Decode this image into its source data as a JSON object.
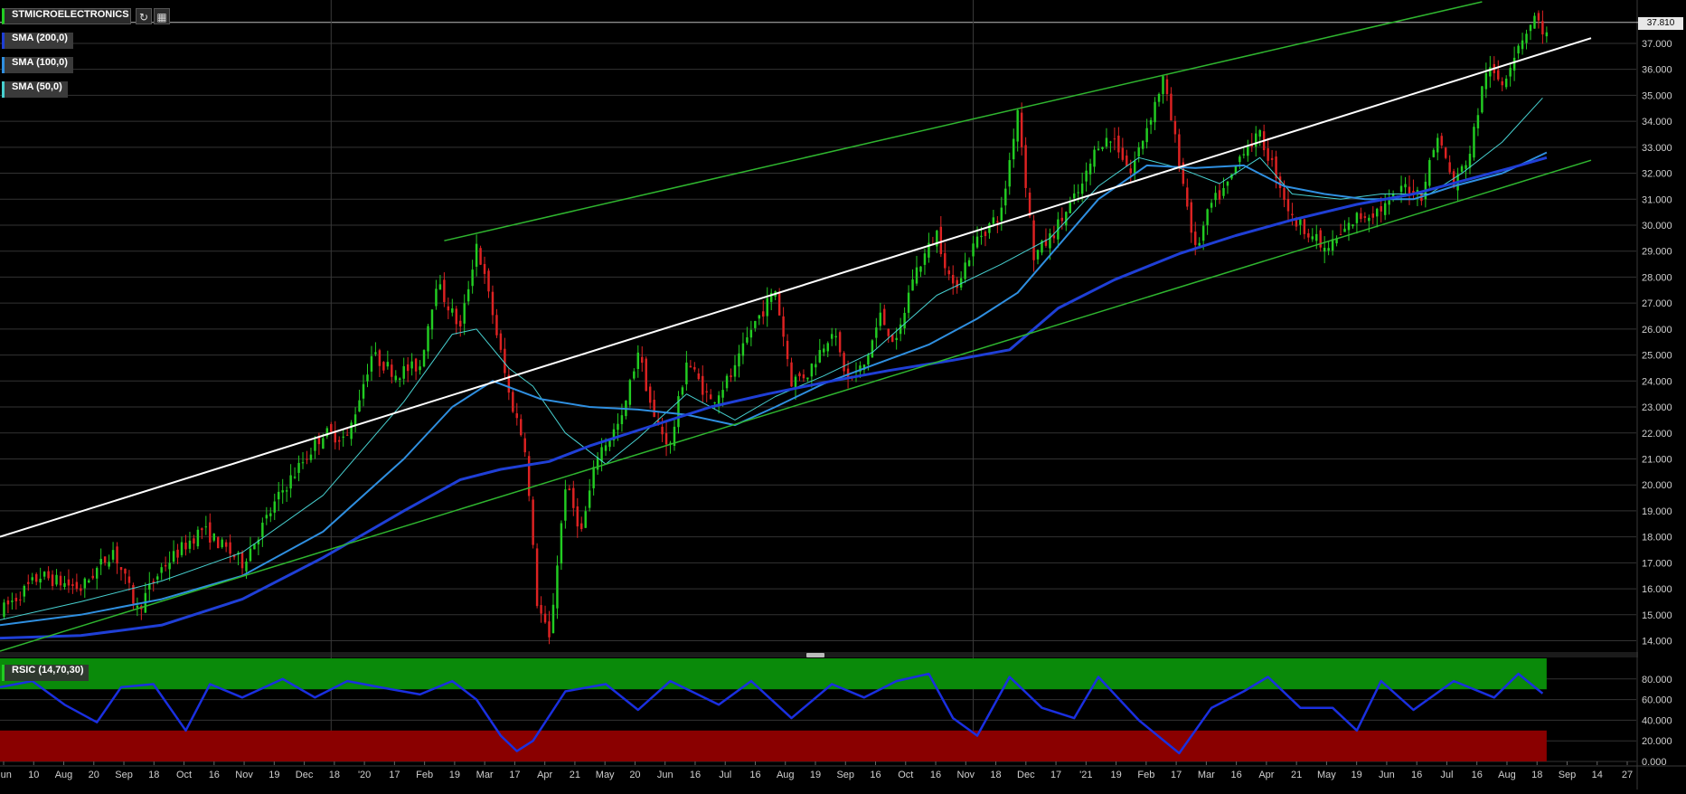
{
  "toolbar": {
    "symbol": "STMICROELECTRONICS",
    "refresh_icon": "refresh-icon",
    "calendar_icon": "calendar-icon"
  },
  "legend": {
    "sma200": "SMA (200,0)",
    "sma100": "SMA (100,0)",
    "sma50": "SMA (50,0)",
    "rsi": "RSIC (14,70,30)"
  },
  "colors": {
    "background": "#000000",
    "up": "#22cc22",
    "down": "#dd2222",
    "sma200": "#1f3fd6",
    "sma100": "#2f8fe0",
    "sma50": "#47d0d0",
    "trend_green": "#2fb52f",
    "trend_white": "#ffffff",
    "rsi_line": "#1a2fe0",
    "overbought_zone": "#0a8a0a",
    "oversold_zone": "#8a0000"
  },
  "chart_data": [
    {
      "type": "candlestick",
      "title": "STMICROELECTRONICS",
      "last_price": "37.810",
      "ylim": [
        13.6,
        38.6
      ],
      "y_ticks": [
        "14.000",
        "15.000",
        "16.000",
        "17.000",
        "18.000",
        "19.000",
        "20.000",
        "21.000",
        "22.000",
        "23.000",
        "24.000",
        "25.000",
        "26.000",
        "27.000",
        "28.000",
        "29.000",
        "30.000",
        "31.000",
        "32.000",
        "33.000",
        "34.000",
        "35.000",
        "36.000",
        "37.000"
      ],
      "x_ticks": [
        "Jun",
        "10",
        "Aug",
        "20",
        "Sep",
        "18",
        "Oct",
        "16",
        "Nov",
        "19",
        "Dec",
        "18",
        "'20",
        "17",
        "Feb",
        "19",
        "Mar",
        "17",
        "Apr",
        "21",
        "May",
        "20",
        "Jun",
        "16",
        "Jul",
        "16",
        "Aug",
        "19",
        "Sep",
        "16",
        "Oct",
        "16",
        "Nov",
        "18",
        "Dec",
        "17",
        "'21",
        "19",
        "Feb",
        "17",
        "Mar",
        "16",
        "Apr",
        "21",
        "May",
        "19",
        "Jun",
        "16",
        "Jul",
        "16",
        "Aug",
        "18",
        "Sep",
        "14",
        "27"
      ],
      "price_path": [
        [
          0,
          15.1
        ],
        [
          10,
          16.5
        ],
        [
          20,
          16.0
        ],
        [
          28,
          17.5
        ],
        [
          34,
          15.2
        ],
        [
          40,
          16.8
        ],
        [
          50,
          18.3
        ],
        [
          60,
          17.0
        ],
        [
          70,
          19.8
        ],
        [
          80,
          22.0
        ],
        [
          86,
          21.8
        ],
        [
          92,
          25.0
        ],
        [
          98,
          24.3
        ],
        [
          104,
          24.6
        ],
        [
          108,
          27.8
        ],
        [
          114,
          26.0
        ],
        [
          118,
          29.3
        ],
        [
          122,
          26.6
        ],
        [
          126,
          23.5
        ],
        [
          130,
          21.5
        ],
        [
          133,
          15.5
        ],
        [
          136,
          14.0
        ],
        [
          140,
          20.0
        ],
        [
          144,
          18.2
        ],
        [
          148,
          21.2
        ],
        [
          154,
          22.5
        ],
        [
          158,
          25.2
        ],
        [
          162,
          22.5
        ],
        [
          166,
          21.5
        ],
        [
          170,
          24.8
        ],
        [
          176,
          23.2
        ],
        [
          182,
          24.4
        ],
        [
          186,
          26.0
        ],
        [
          192,
          27.5
        ],
        [
          196,
          24.0
        ],
        [
          200,
          24.3
        ],
        [
          206,
          26.0
        ],
        [
          210,
          24.0
        ],
        [
          214,
          24.6
        ],
        [
          218,
          26.5
        ],
        [
          222,
          25.4
        ],
        [
          226,
          28.0
        ],
        [
          232,
          29.7
        ],
        [
          236,
          27.5
        ],
        [
          242,
          29.5
        ],
        [
          248,
          30.5
        ],
        [
          252,
          34.5
        ],
        [
          256,
          28.8
        ],
        [
          260,
          29.5
        ],
        [
          264,
          30.5
        ],
        [
          268,
          31.5
        ],
        [
          272,
          33.2
        ],
        [
          276,
          33.3
        ],
        [
          280,
          32.0
        ],
        [
          284,
          33.8
        ],
        [
          288,
          35.6
        ],
        [
          292,
          32.5
        ],
        [
          296,
          29.0
        ],
        [
          300,
          30.8
        ],
        [
          304,
          31.5
        ],
        [
          308,
          33.0
        ],
        [
          312,
          33.4
        ],
        [
          316,
          32.0
        ],
        [
          320,
          30.2
        ],
        [
          324,
          29.8
        ],
        [
          328,
          29.0
        ],
        [
          332,
          29.6
        ],
        [
          336,
          30.3
        ],
        [
          340,
          30.5
        ],
        [
          344,
          30.8
        ],
        [
          348,
          31.5
        ],
        [
          352,
          31.2
        ],
        [
          356,
          33.5
        ],
        [
          360,
          31.5
        ],
        [
          364,
          32.8
        ],
        [
          368,
          36.0
        ],
        [
          372,
          35.5
        ],
        [
          376,
          37.0
        ],
        [
          380,
          38.0
        ],
        [
          383,
          37.3
        ]
      ],
      "sma50": [
        [
          0,
          14.8
        ],
        [
          20,
          15.5
        ],
        [
          40,
          16.3
        ],
        [
          60,
          17.4
        ],
        [
          80,
          19.6
        ],
        [
          100,
          23.2
        ],
        [
          112,
          25.8
        ],
        [
          118,
          26.0
        ],
        [
          126,
          24.5
        ],
        [
          132,
          23.8
        ],
        [
          140,
          22.0
        ],
        [
          150,
          20.8
        ],
        [
          158,
          21.8
        ],
        [
          170,
          23.5
        ],
        [
          182,
          22.5
        ],
        [
          192,
          23.4
        ],
        [
          204,
          24.2
        ],
        [
          216,
          25.1
        ],
        [
          232,
          27.3
        ],
        [
          248,
          28.5
        ],
        [
          260,
          29.5
        ],
        [
          272,
          31.5
        ],
        [
          282,
          32.6
        ],
        [
          292,
          32.2
        ],
        [
          302,
          31.6
        ],
        [
          312,
          32.6
        ],
        [
          320,
          31.2
        ],
        [
          332,
          31.0
        ],
        [
          342,
          31.2
        ],
        [
          354,
          31.2
        ],
        [
          362,
          32.0
        ],
        [
          372,
          33.2
        ],
        [
          382,
          34.9
        ]
      ],
      "sma100": [
        [
          0,
          14.6
        ],
        [
          20,
          15.0
        ],
        [
          40,
          15.6
        ],
        [
          60,
          16.5
        ],
        [
          80,
          18.2
        ],
        [
          100,
          21.0
        ],
        [
          112,
          23.0
        ],
        [
          122,
          24.0
        ],
        [
          134,
          23.3
        ],
        [
          146,
          23.0
        ],
        [
          158,
          22.9
        ],
        [
          170,
          22.7
        ],
        [
          182,
          22.3
        ],
        [
          192,
          23.0
        ],
        [
          204,
          23.9
        ],
        [
          216,
          24.6
        ],
        [
          230,
          25.4
        ],
        [
          242,
          26.4
        ],
        [
          252,
          27.4
        ],
        [
          262,
          29.2
        ],
        [
          272,
          31.0
        ],
        [
          284,
          32.3
        ],
        [
          296,
          32.2
        ],
        [
          308,
          32.3
        ],
        [
          318,
          31.5
        ],
        [
          328,
          31.2
        ],
        [
          338,
          31.0
        ],
        [
          350,
          31.0
        ],
        [
          360,
          31.5
        ],
        [
          372,
          32.0
        ],
        [
          383,
          32.8
        ]
      ],
      "sma200": [
        [
          0,
          14.1
        ],
        [
          20,
          14.2
        ],
        [
          40,
          14.6
        ],
        [
          60,
          15.6
        ],
        [
          80,
          17.2
        ],
        [
          100,
          19.0
        ],
        [
          114,
          20.2
        ],
        [
          124,
          20.6
        ],
        [
          136,
          20.9
        ],
        [
          146,
          21.5
        ],
        [
          160,
          22.2
        ],
        [
          176,
          23.0
        ],
        [
          190,
          23.5
        ],
        [
          206,
          24.0
        ],
        [
          220,
          24.4
        ],
        [
          236,
          24.8
        ],
        [
          250,
          25.2
        ],
        [
          262,
          26.8
        ],
        [
          276,
          27.9
        ],
        [
          292,
          28.9
        ],
        [
          306,
          29.6
        ],
        [
          320,
          30.2
        ],
        [
          336,
          30.8
        ],
        [
          350,
          31.2
        ],
        [
          362,
          31.7
        ],
        [
          374,
          32.2
        ],
        [
          383,
          32.6
        ]
      ],
      "trend_upper_green": [
        [
          110,
          29.4
        ],
        [
          367,
          38.6
        ]
      ],
      "trend_lower_green": [
        [
          0,
          13.6
        ],
        [
          394,
          32.5
        ]
      ],
      "trend_white": [
        [
          0,
          18.0
        ],
        [
          394,
          37.2
        ]
      ]
    },
    {
      "type": "line",
      "title": "RSIC (14,70,30)",
      "ylim": [
        0,
        100
      ],
      "y_ticks": [
        "0.000",
        "20.000",
        "40.000",
        "60.000",
        "80.000"
      ],
      "overbought": 70,
      "oversold": 30,
      "values": [
        [
          0,
          72
        ],
        [
          8,
          78
        ],
        [
          16,
          55
        ],
        [
          24,
          38
        ],
        [
          30,
          72
        ],
        [
          38,
          75
        ],
        [
          46,
          30
        ],
        [
          52,
          75
        ],
        [
          60,
          62
        ],
        [
          70,
          80
        ],
        [
          78,
          62
        ],
        [
          86,
          78
        ],
        [
          94,
          72
        ],
        [
          104,
          65
        ],
        [
          112,
          78
        ],
        [
          118,
          60
        ],
        [
          124,
          25
        ],
        [
          128,
          10
        ],
        [
          132,
          20
        ],
        [
          140,
          68
        ],
        [
          150,
          75
        ],
        [
          158,
          50
        ],
        [
          166,
          78
        ],
        [
          178,
          55
        ],
        [
          186,
          78
        ],
        [
          196,
          42
        ],
        [
          206,
          75
        ],
        [
          214,
          62
        ],
        [
          222,
          78
        ],
        [
          230,
          85
        ],
        [
          236,
          42
        ],
        [
          242,
          25
        ],
        [
          250,
          82
        ],
        [
          258,
          52
        ],
        [
          266,
          42
        ],
        [
          272,
          82
        ],
        [
          282,
          40
        ],
        [
          292,
          8
        ],
        [
          300,
          52
        ],
        [
          308,
          68
        ],
        [
          314,
          82
        ],
        [
          322,
          52
        ],
        [
          330,
          52
        ],
        [
          336,
          30
        ],
        [
          342,
          78
        ],
        [
          350,
          50
        ],
        [
          360,
          78
        ],
        [
          370,
          62
        ],
        [
          376,
          85
        ],
        [
          382,
          66
        ]
      ]
    }
  ]
}
